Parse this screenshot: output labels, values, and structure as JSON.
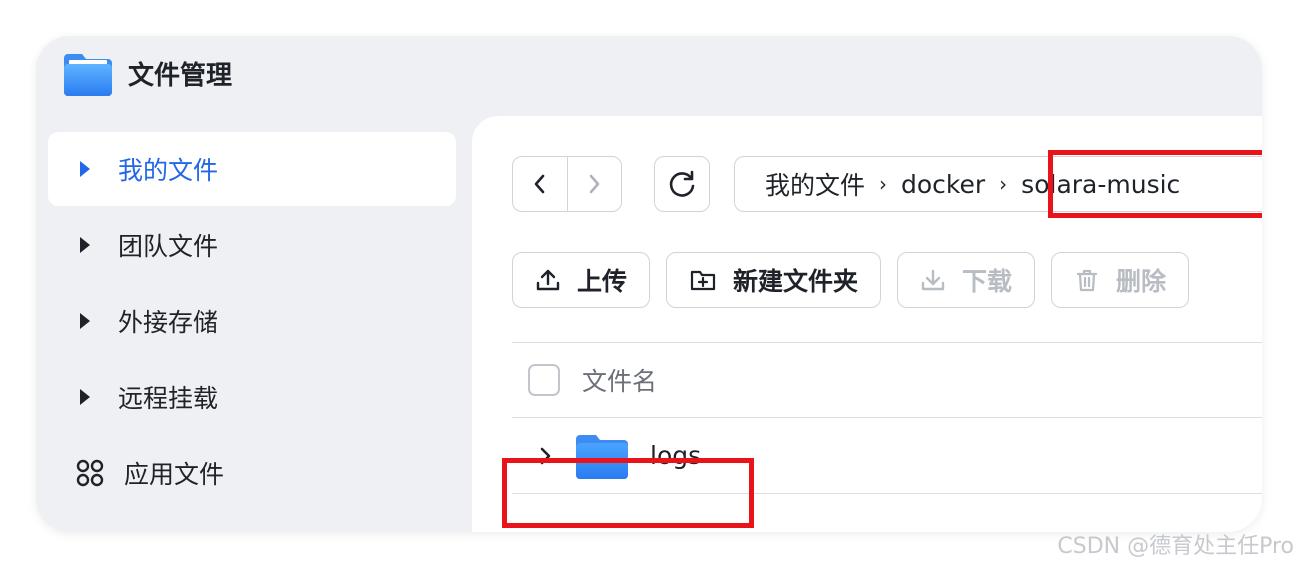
{
  "app": {
    "title": "文件管理",
    "icon": "folder-app-icon",
    "accent": "#2366e8"
  },
  "sidebar": {
    "items": [
      {
        "label": "我的文件",
        "icon": "caret-right-icon",
        "active": true
      },
      {
        "label": "团队文件",
        "icon": "caret-right-icon",
        "active": false
      },
      {
        "label": "外接存储",
        "icon": "caret-right-icon",
        "active": false
      },
      {
        "label": "远程挂载",
        "icon": "caret-right-icon",
        "active": false
      },
      {
        "label": "应用文件",
        "icon": "apps-grid-icon",
        "active": false
      }
    ]
  },
  "breadcrumb": {
    "items": [
      "我的文件",
      "docker",
      "solara-music"
    ],
    "separator": "›"
  },
  "toolbar": {
    "upload": "上传",
    "new_folder": "新建文件夹",
    "download": "下载",
    "delete": "删除"
  },
  "table": {
    "header_name": "文件名",
    "rows": [
      {
        "name": "logs",
        "type": "folder"
      }
    ]
  },
  "annotation_color": "#e8141a",
  "watermark": "CSDN @德育处主任Pro"
}
